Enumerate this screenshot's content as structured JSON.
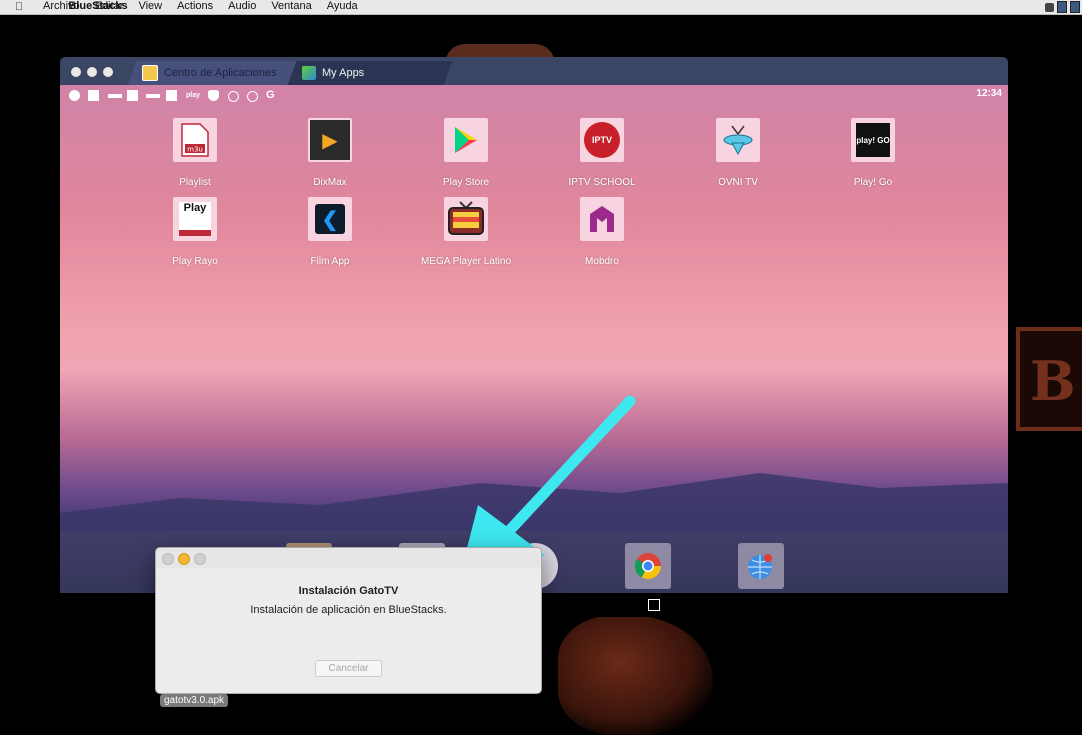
{
  "menubar": {
    "apple": "",
    "items": [
      "BlueStacks",
      "Archivo",
      "Editar",
      "View",
      "Actions",
      "Audio",
      "Ventana",
      "Ayuda"
    ]
  },
  "background": {
    "sign_text": "B"
  },
  "window": {
    "tabs": [
      {
        "label": "Centro de Aplicaciones"
      },
      {
        "label": "My Apps"
      }
    ]
  },
  "android": {
    "clock": "12:34",
    "status_small": [
      "play",
      "play"
    ],
    "apps": [
      {
        "label": "Playlist",
        "icon": "playlist-m3u-icon",
        "glyph": "m3u"
      },
      {
        "label": "DixMax",
        "icon": "dixmax-icon",
        "glyph": "▶"
      },
      {
        "label": "Play Store",
        "icon": "play-store-icon",
        "glyph": "▶"
      },
      {
        "label": "IPTV SCHOOL",
        "icon": "iptv-school-icon",
        "glyph": "IPTV"
      },
      {
        "label": "OVNI TV",
        "icon": "ovni-tv-icon",
        "glyph": ""
      },
      {
        "label": "Play! Go",
        "icon": "play-go-icon",
        "glyph": "play! GO"
      },
      {
        "label": "Play Rayo",
        "icon": "play-rayo-icon",
        "glyph": "Play"
      },
      {
        "label": "Film App",
        "icon": "film-app-icon",
        "glyph": "❮"
      },
      {
        "label": "MEGA Player Latino",
        "icon": "mega-player-icon",
        "glyph": ""
      },
      {
        "label": "Mobdro",
        "icon": "mobdro-icon",
        "glyph": ""
      }
    ]
  },
  "dialog": {
    "title": "Instalación GatoTV",
    "message": "Instalación de aplicación en BlueStacks.",
    "cancel": "Cancelar"
  },
  "file_label": "gatotv3.0.apk",
  "colors": {
    "arrow": "#3ee8f0",
    "titlebar": "#3b4564"
  }
}
